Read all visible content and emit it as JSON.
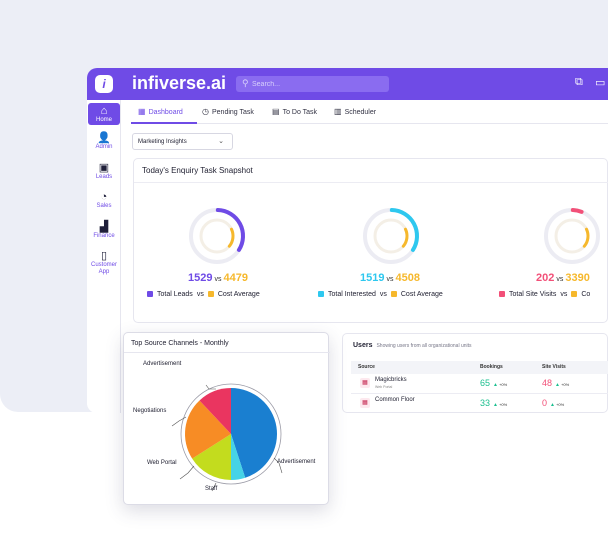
{
  "app": {
    "brand": "infiverse.ai",
    "logo_letter": "i",
    "search_placeholder": "Search..."
  },
  "sidebar": {
    "items": [
      {
        "label": "Home",
        "icon": "home-icon",
        "glyph": "⌂"
      },
      {
        "label": "Admin",
        "icon": "admin-icon",
        "glyph": "👤"
      },
      {
        "label": "Leads",
        "icon": "leads-icon",
        "glyph": "▣"
      },
      {
        "label": "Sales",
        "icon": "sales-icon",
        "glyph": "◔"
      },
      {
        "label": "Finance",
        "icon": "finance-icon",
        "glyph": "▟"
      },
      {
        "label": "Customer",
        "label2": "App",
        "icon": "customer-app-icon",
        "glyph": "▯"
      }
    ]
  },
  "tabs": [
    {
      "label": "Dashboard",
      "glyph": "▦"
    },
    {
      "label": "Pending Task",
      "glyph": "◷"
    },
    {
      "label": "To Do Task",
      "glyph": "▤"
    },
    {
      "label": "Scheduler",
      "glyph": "▥"
    }
  ],
  "filter": {
    "selected": "Marketing Insights",
    "chevron": "⌄"
  },
  "snapshot": {
    "title": "Today's Enquiry Task Snapshot",
    "gauges": [
      {
        "value": "1529",
        "vs": "vs",
        "compare": "4479",
        "value_color": "#6f4be6",
        "compare_color": "#f6b82c",
        "fill": 0.34,
        "legend_a": "Total Leads",
        "legend_vs": "vs",
        "legend_b": "Cost Average",
        "swatch_a": "#6f4be6",
        "swatch_b": "#f6b82c"
      },
      {
        "value": "1519",
        "vs": "vs",
        "compare": "4508",
        "value_color": "#2ec8ef",
        "compare_color": "#f6b82c",
        "fill": 0.34,
        "legend_a": "Total Interested",
        "legend_vs": "vs",
        "legend_b": "Cost Average",
        "swatch_a": "#2ec8ef",
        "swatch_b": "#f6b82c"
      },
      {
        "value": "202",
        "vs": "vs",
        "compare": "3390",
        "value_color": "#f25078",
        "compare_color": "#f6b82c",
        "fill": 0.06,
        "legend_a": "Total Site Visits",
        "legend_vs": "vs",
        "legend_b": "Co",
        "swatch_a": "#f25078",
        "swatch_b": "#f6b82c"
      }
    ]
  },
  "users": {
    "title": "Users",
    "subtitle": "Showing users from all organizational units",
    "headers": [
      "Source",
      "Bookings",
      "Site Visits"
    ],
    "rows": [
      {
        "name": "Magicbricks",
        "sub": "Web Portal",
        "bookings": "65",
        "bookings_delta": "+0%",
        "visits": "48",
        "visits_delta": "+0%"
      },
      {
        "name": "Common Floor",
        "sub": "",
        "bookings": "33",
        "bookings_delta": "+0%",
        "visits": "0",
        "visits_delta": "+0%"
      }
    ]
  },
  "pie_card": {
    "title": "Top Source Channels - Monthly",
    "labels": [
      "Advertisement",
      "Negotiations",
      "Web Portal",
      "Staff",
      "Advertisement"
    ]
  },
  "chart_data": {
    "type": "pie",
    "title": "Top Source Channels - Monthly",
    "series": [
      {
        "name": "Advertisement",
        "values": [
          0.45
        ],
        "color": "#1a7fd0"
      },
      {
        "name": "Staff",
        "values": [
          0.05
        ],
        "color": "#46d3e6"
      },
      {
        "name": "Web Portal",
        "values": [
          0.16
        ],
        "color": "#c3dc1e"
      },
      {
        "name": "Negotiations",
        "values": [
          0.22
        ],
        "color": "#f78c25"
      },
      {
        "name": "Advertisement",
        "values": [
          0.12
        ],
        "color": "#ea3560"
      }
    ]
  }
}
